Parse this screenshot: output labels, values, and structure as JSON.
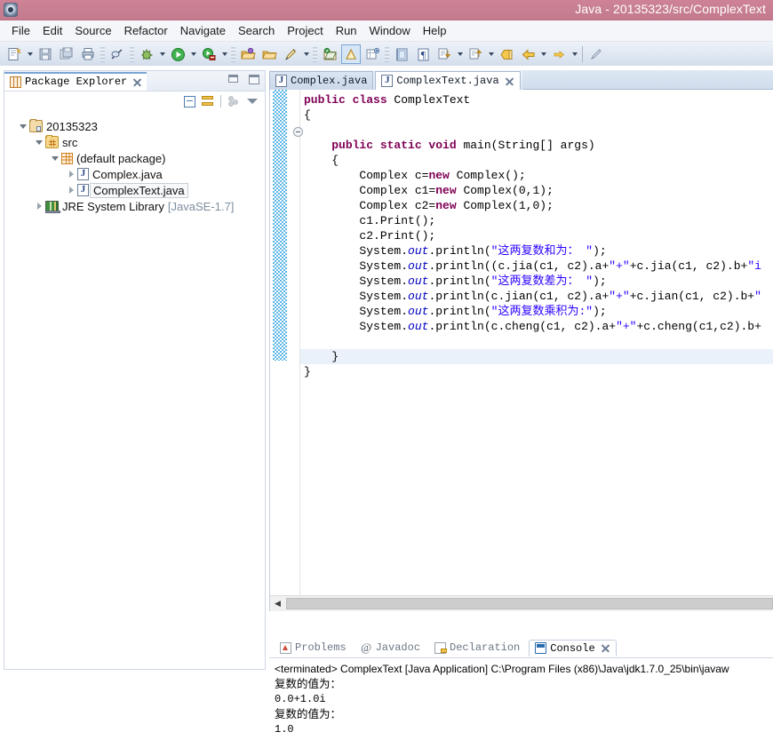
{
  "window": {
    "title": "Java - 20135323/src/ComplexText",
    "app_icon": "eclipse-icon"
  },
  "menubar": {
    "items": [
      {
        "label": "File"
      },
      {
        "label": "Edit"
      },
      {
        "label": "Source"
      },
      {
        "label": "Refactor"
      },
      {
        "label": "Navigate"
      },
      {
        "label": "Search"
      },
      {
        "label": "Project"
      },
      {
        "label": "Run"
      },
      {
        "label": "Window"
      },
      {
        "label": "Help"
      }
    ]
  },
  "toolbar": {
    "buttons": [
      "new-wizard-icon",
      "save-icon",
      "save-all-icon",
      "print-icon",
      "toggle-breakpoint-icon",
      "debug-icon",
      "run-icon",
      "run-external-tools-icon",
      "open-type-icon",
      "open-task-icon",
      "search-icon",
      "next-annotation-icon",
      "previous-annotation-icon",
      "last-edit-location-icon",
      "back-icon",
      "forward-icon",
      "new-java-class-icon"
    ]
  },
  "package_explorer": {
    "tab_label": "Package Explorer",
    "tab_icon": "package-explorer-icon",
    "close_icon": "close-icon",
    "minimize_icon": "minimize-icon",
    "maximize_icon": "maximize-icon",
    "view_buttons": [
      "collapse-all-icon",
      "link-with-editor-icon",
      "focus-on-active-task-icon",
      "view-menu-icon"
    ],
    "tree": [
      {
        "label": "20135323",
        "icon": "java-project-icon",
        "indent": 0,
        "twisty": "open",
        "selected": false,
        "sub": ""
      },
      {
        "label": "src",
        "icon": "source-folder-icon",
        "indent": 1,
        "twisty": "open",
        "selected": false,
        "sub": ""
      },
      {
        "label": "(default package)",
        "icon": "package-icon",
        "indent": 2,
        "twisty": "open",
        "selected": false,
        "sub": ""
      },
      {
        "label": "Complex.java",
        "icon": "java-file-icon",
        "indent": 3,
        "twisty": "closed",
        "selected": false,
        "sub": ""
      },
      {
        "label": "ComplexText.java",
        "icon": "java-file-icon",
        "indent": 3,
        "twisty": "closed",
        "selected": true,
        "sub": ""
      },
      {
        "label": "JRE System Library",
        "icon": "jre-library-icon",
        "indent": 1,
        "twisty": "closed",
        "selected": false,
        "sub": "[JavaSE-1.7]"
      }
    ]
  },
  "editor": {
    "tabs": [
      {
        "label": "Complex.java",
        "icon": "java-file-icon",
        "active": false,
        "close": ""
      },
      {
        "label": "ComplexText.java",
        "icon": "java-file-icon",
        "active": true,
        "close": "close-icon"
      }
    ],
    "code_lines": [
      [
        {
          "t": "public ",
          "c": "kw"
        },
        {
          "t": "class ",
          "c": "kw"
        },
        {
          "t": "ComplexText",
          "c": ""
        }
      ],
      [
        {
          "t": "{",
          "c": ""
        }
      ],
      [],
      [
        {
          "t": "    ",
          "c": ""
        },
        {
          "t": "public static void ",
          "c": "kw"
        },
        {
          "t": "main(String[] args)",
          "c": ""
        }
      ],
      [
        {
          "t": "    {",
          "c": ""
        }
      ],
      [
        {
          "t": "        Complex c=",
          "c": ""
        },
        {
          "t": "new ",
          "c": "kw"
        },
        {
          "t": "Complex();",
          "c": ""
        }
      ],
      [
        {
          "t": "        Complex c1=",
          "c": ""
        },
        {
          "t": "new ",
          "c": "kw"
        },
        {
          "t": "Complex(0,1);",
          "c": ""
        }
      ],
      [
        {
          "t": "        Complex c2=",
          "c": ""
        },
        {
          "t": "new ",
          "c": "kw"
        },
        {
          "t": "Complex(1,0);",
          "c": ""
        }
      ],
      [
        {
          "t": "        c1.Print();",
          "c": ""
        }
      ],
      [
        {
          "t": "        c2.Print();",
          "c": ""
        }
      ],
      [
        {
          "t": "        System.",
          "c": ""
        },
        {
          "t": "out",
          "c": "fld"
        },
        {
          "t": ".println(",
          "c": ""
        },
        {
          "t": "\"这两复数和为： \"",
          "c": "str"
        },
        {
          "t": ");",
          "c": ""
        }
      ],
      [
        {
          "t": "        System.",
          "c": ""
        },
        {
          "t": "out",
          "c": "fld"
        },
        {
          "t": ".println((c.jia(c1, c2).a+",
          "c": ""
        },
        {
          "t": "\"+\"",
          "c": "str"
        },
        {
          "t": "+c.jia(c1, c2).b+",
          "c": ""
        },
        {
          "t": "\"i",
          "c": "str"
        }
      ],
      [
        {
          "t": "        System.",
          "c": ""
        },
        {
          "t": "out",
          "c": "fld"
        },
        {
          "t": ".println(",
          "c": ""
        },
        {
          "t": "\"这两复数差为： \"",
          "c": "str"
        },
        {
          "t": ");",
          "c": ""
        }
      ],
      [
        {
          "t": "        System.",
          "c": ""
        },
        {
          "t": "out",
          "c": "fld"
        },
        {
          "t": ".println(c.jian(c1, c2).a+",
          "c": ""
        },
        {
          "t": "\"+\"",
          "c": "str"
        },
        {
          "t": "+c.jian(c1, c2).b+",
          "c": ""
        },
        {
          "t": "\"",
          "c": "str"
        }
      ],
      [
        {
          "t": "        System.",
          "c": ""
        },
        {
          "t": "out",
          "c": "fld"
        },
        {
          "t": ".println(",
          "c": ""
        },
        {
          "t": "\"这两复数乘积为:\"",
          "c": "str"
        },
        {
          "t": ");",
          "c": ""
        }
      ],
      [
        {
          "t": "        System.",
          "c": ""
        },
        {
          "t": "out",
          "c": "fld"
        },
        {
          "t": ".println(c.cheng(c1, c2).a+",
          "c": ""
        },
        {
          "t": "\"+\"",
          "c": "str"
        },
        {
          "t": "+c.cheng(c1,c2).b+",
          "c": ""
        }
      ],
      [],
      [
        {
          "t": "    }",
          "c": ""
        }
      ],
      [
        {
          "t": "}",
          "c": ""
        }
      ]
    ],
    "fold_marker": "collapse-fold-icon",
    "hscroll": {
      "left_arrow": "scroll-left-icon"
    }
  },
  "console": {
    "tabs": [
      {
        "label": "Problems",
        "icon": "problems-icon",
        "active": false
      },
      {
        "label": "Javadoc",
        "icon": "javadoc-icon",
        "active": false
      },
      {
        "label": "Declaration",
        "icon": "declaration-icon",
        "active": false
      },
      {
        "label": "Console",
        "icon": "console-icon",
        "active": true,
        "close": "close-icon"
      }
    ],
    "output": [
      {
        "text": "<terminated> ComplexText [Java Application] C:\\Program Files (x86)\\Java\\jdk1.7.0_25\\bin\\javaw",
        "style": "term"
      },
      {
        "text": "复数的值为：",
        "style": "cjk"
      },
      {
        "text": "0.0+1.0i",
        "style": "mono"
      },
      {
        "text": "复数的值为：",
        "style": "cjk"
      },
      {
        "text": "1.0",
        "style": "mono"
      }
    ]
  },
  "colors": {
    "title_bar": "#c77f92",
    "keyword": "#7f0055",
    "string": "#2a00ff",
    "field": "#0000c0",
    "selection_marker": "#5bb6e8",
    "current_line": "#eaf1fb"
  }
}
